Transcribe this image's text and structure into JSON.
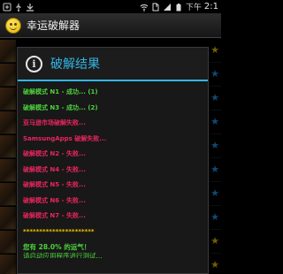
{
  "status_bar": {
    "icons_left": [
      "notification-icon",
      "usb-icon",
      "download-icon"
    ],
    "icons_right": [
      "wifi-icon",
      "sim-icon",
      "signal-icon",
      "battery-icon"
    ],
    "am_pm": "下午",
    "time": "2:1"
  },
  "app": {
    "title": "幸运破解器",
    "logo": "smiley-logo"
  },
  "dialog": {
    "icon": "info-icon",
    "title": "破解结果",
    "lines": [
      {
        "text": "破解模式 N1 - 成功... (1)",
        "status": "success"
      },
      {
        "text": "破解模式 N3 - 成功... (2)",
        "status": "success"
      },
      {
        "text": "亚马逊市场破解失败...",
        "status": "fail"
      },
      {
        "text": "SamsungApps 破解失败...",
        "status": "fail"
      },
      {
        "text": "破解模式 N2 - 失败...",
        "status": "fail"
      },
      {
        "text": "破解模式 N4 - 失败...",
        "status": "fail"
      },
      {
        "text": "破解模式 N5 - 失败...",
        "status": "fail"
      },
      {
        "text": "破解模式 N6 - 失败...",
        "status": "fail"
      },
      {
        "text": "破解模式 N7 - 失败...",
        "status": "fail"
      }
    ],
    "separator": "**********************",
    "luck_prefix": "您有 ",
    "luck_value": "28.0%",
    "luck_suffix": " 的运气！",
    "hint": "请启动应用程序进行测试..."
  },
  "colors": {
    "accent": "#33b5e5",
    "success": "#4cd23c",
    "fail": "#e8255e",
    "separator": "#f2c200"
  }
}
